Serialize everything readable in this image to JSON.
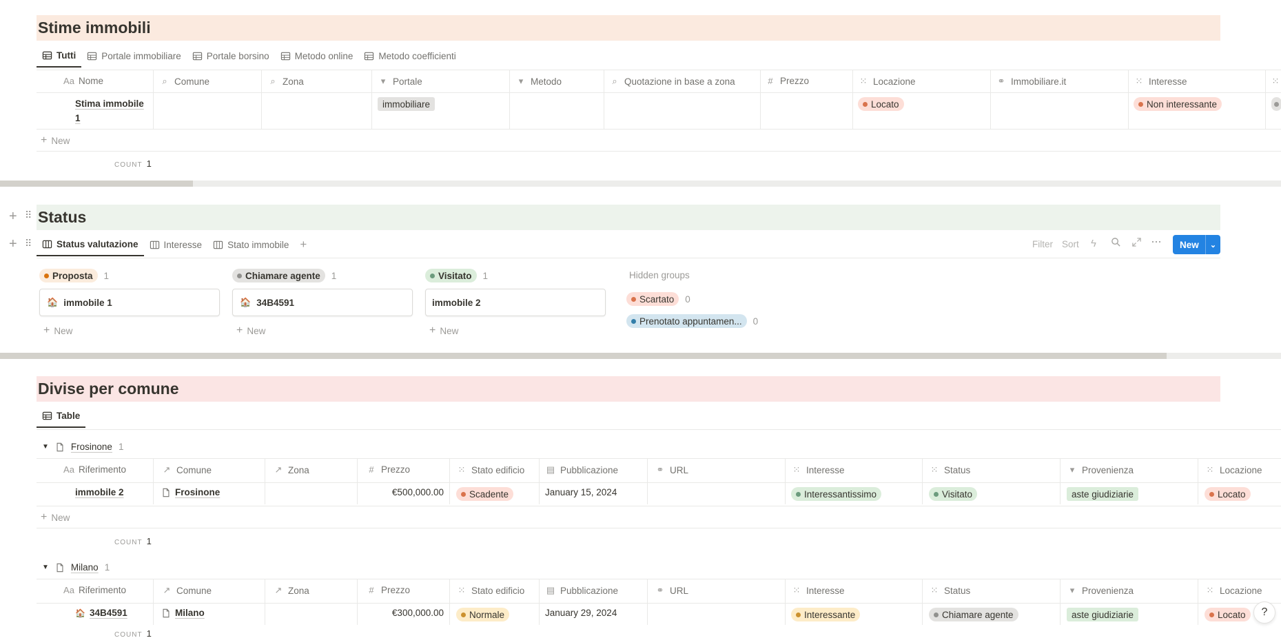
{
  "colors": {
    "peach_header": "#fbeadf",
    "green_header": "#edf3ec",
    "pink_header": "#fbe5e4",
    "accent_blue": "#2383e2"
  },
  "section1": {
    "title": "Stime immobili",
    "tabs": [
      {
        "label": "Tutti",
        "icon": "table-icon"
      },
      {
        "label": "Portale immobiliare",
        "icon": "table-icon"
      },
      {
        "label": "Portale borsino",
        "icon": "table-icon"
      },
      {
        "label": "Metodo online",
        "icon": "table-icon"
      },
      {
        "label": "Metodo coefficienti",
        "icon": "table-icon"
      }
    ],
    "columns": [
      {
        "icon_glyph": "Aa",
        "label": "Nome"
      },
      {
        "icon_glyph": "⌕",
        "label": "Comune"
      },
      {
        "icon_glyph": "⌕",
        "label": "Zona"
      },
      {
        "icon_glyph": "▾",
        "label": "Portale"
      },
      {
        "icon_glyph": "▾",
        "label": "Metodo"
      },
      {
        "icon_glyph": "⌕",
        "label": "Quotazione in base a zona"
      },
      {
        "icon_glyph": "#",
        "label": "Prezzo"
      },
      {
        "icon_glyph": "⁙",
        "label": "Locazione"
      },
      {
        "icon_glyph": "⚭",
        "label": "Immobiliare.it"
      },
      {
        "icon_glyph": "⁙",
        "label": "Interesse"
      }
    ],
    "row": {
      "name_line1": "Stima immobile",
      "name_line2": "1",
      "portale": "immobiliare",
      "locazione": "Locato",
      "interesse": "Non interessante"
    },
    "new_label": "New",
    "count_label": "COUNT",
    "count_value": "1"
  },
  "section2": {
    "title": "Status",
    "tabs": [
      {
        "label": "Status valutazione",
        "icon": "board-icon"
      },
      {
        "label": "Interesse",
        "icon": "board-icon"
      },
      {
        "label": "Stato immobile",
        "icon": "board-icon"
      }
    ],
    "toolbar": {
      "filter": "Filter",
      "sort": "Sort",
      "new": "New"
    },
    "groups": [
      {
        "label": "Proposta",
        "count": "1",
        "card": "immobile 1",
        "new": "New"
      },
      {
        "label": "Chiamare agente",
        "count": "1",
        "card": "34B4591",
        "new": "New"
      },
      {
        "label": "Visitato",
        "count": "1",
        "card": "immobile 2",
        "new": "New"
      }
    ],
    "hidden_groups_label": "Hidden groups",
    "hidden_groups": [
      {
        "label": "Scartato",
        "count": "0"
      },
      {
        "label": "Prenotato appuntamen...",
        "count": "0"
      }
    ]
  },
  "section3": {
    "title": "Divise per comune",
    "tabs": [
      {
        "label": "Table",
        "icon": "table-icon"
      }
    ],
    "columns": [
      {
        "icon_glyph": "Aa",
        "label": "Riferimento"
      },
      {
        "icon_glyph": "↗",
        "label": "Comune"
      },
      {
        "icon_glyph": "↗",
        "label": "Zona"
      },
      {
        "icon_glyph": "#",
        "label": "Prezzo"
      },
      {
        "icon_glyph": "⁙",
        "label": "Stato edificio"
      },
      {
        "icon_glyph": "▤",
        "label": "Pubblicazione"
      },
      {
        "icon_glyph": "⚭",
        "label": "URL"
      },
      {
        "icon_glyph": "⁙",
        "label": "Interesse"
      },
      {
        "icon_glyph": "⁙",
        "label": "Status"
      },
      {
        "icon_glyph": "▾",
        "label": "Provenienza"
      },
      {
        "icon_glyph": "⁙",
        "label": "Locazione"
      }
    ],
    "groups": [
      {
        "name": "Frosinone",
        "count": "1",
        "row": {
          "riferimento": "immobile 2",
          "comune": "Frosinone",
          "prezzo": "€500,000.00",
          "stato_edificio": "Scadente",
          "pubblicazione": "January 15, 2024",
          "interesse": "Interessantissimo",
          "status": "Visitato",
          "provenienza": "aste giudiziarie",
          "locazione": "Locato"
        }
      },
      {
        "name": "Milano",
        "count": "1",
        "row": {
          "riferimento": "34B4591",
          "comune": "Milano",
          "prezzo": "€300,000.00",
          "stato_edificio": "Normale",
          "pubblicazione": "January 29, 2024",
          "interesse": "Interessante",
          "status": "Chiamare agente",
          "provenienza": "aste giudiziarie",
          "locazione": "Locato"
        }
      }
    ],
    "new_label": "New",
    "count_label": "COUNT",
    "count_value": "1"
  },
  "help_button": "?",
  "scroll_progress": {
    "section1_thumb_fraction": 0.15,
    "section2_thumb_fraction": 0.91
  }
}
